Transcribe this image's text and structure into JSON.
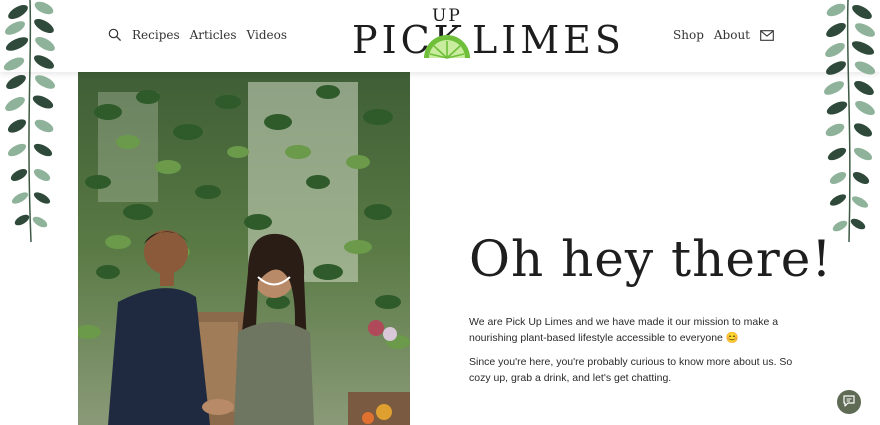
{
  "nav": {
    "recipes": "Recipes",
    "articles": "Articles",
    "videos": "Videos",
    "shop": "Shop",
    "about": "About"
  },
  "logo": {
    "word_pick": "PICK",
    "word_up": "UP",
    "word_limes": "LIMES",
    "icon": "lime-slice-icon"
  },
  "intro": {
    "title": "Oh hey there!",
    "paragraph_1": "We are Pick Up Limes and we have made it our mission to make a nourishing plant-based lifestyle accessible to everyone 😊",
    "paragraph_2": "Since you're here, you're probably curious to know more about us. So cozy up, grab a drink, and let's get chatting."
  },
  "icons": {
    "search": "search-icon",
    "mail": "mail-icon",
    "chat": "chat-icon"
  },
  "colors": {
    "lime": "#6fbf3a",
    "leaf_dark": "#2f4a3a",
    "leaf_light": "#8fb29a",
    "chat_button": "#5f6b55"
  }
}
